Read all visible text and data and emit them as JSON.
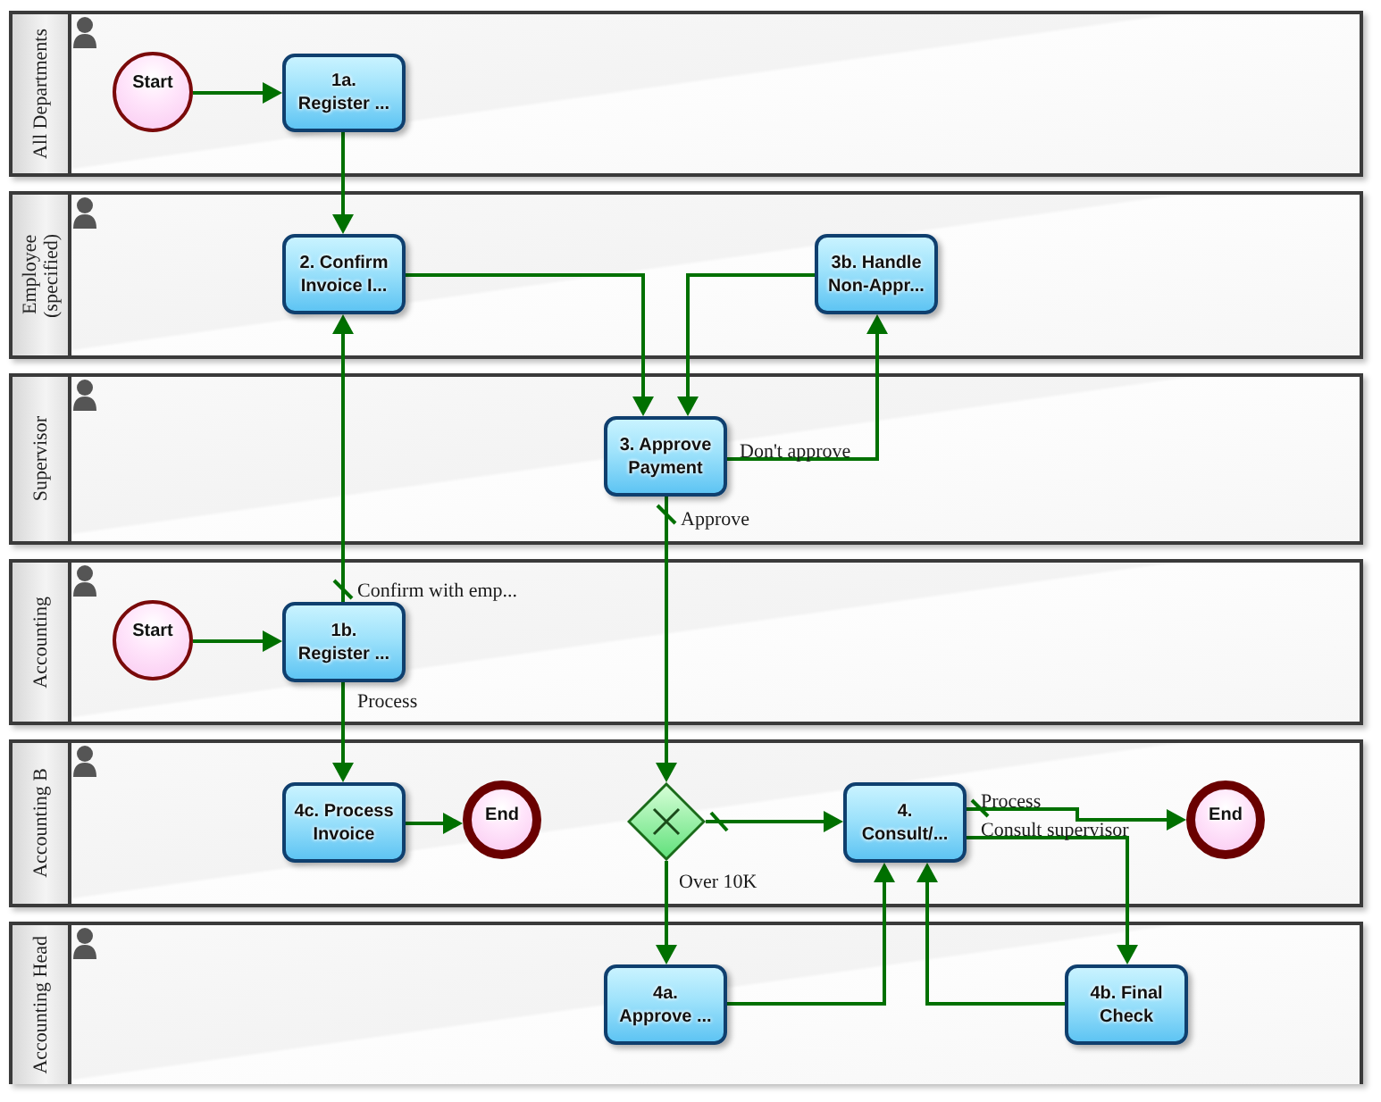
{
  "lanes": [
    {
      "label": "All Departments",
      "nodes": [
        {
          "kind": "start",
          "label": "Start"
        },
        {
          "kind": "task",
          "label": "1a.\nRegister ..."
        }
      ]
    },
    {
      "label": "Employee (specified)",
      "nodes": [
        {
          "kind": "task",
          "label": "2. Confirm\nInvoice I..."
        },
        {
          "kind": "task",
          "label": "3b. Handle\nNon-Appr..."
        }
      ]
    },
    {
      "label": "Supervisor",
      "nodes": [
        {
          "kind": "task",
          "label": "3. Approve\nPayment"
        }
      ]
    },
    {
      "label": "Accounting",
      "nodes": [
        {
          "kind": "start",
          "label": "Start"
        },
        {
          "kind": "task",
          "label": "1b.\nRegister ..."
        }
      ]
    },
    {
      "label": "Accounting B",
      "nodes": [
        {
          "kind": "task",
          "label": "4c. Process\nInvoice"
        },
        {
          "kind": "end",
          "label": "End"
        },
        {
          "kind": "gateway"
        },
        {
          "kind": "task",
          "label": "4.\nConsult/..."
        },
        {
          "kind": "end",
          "label": "End"
        }
      ]
    },
    {
      "label": "Accounting Head",
      "nodes": [
        {
          "kind": "task",
          "label": "4a.\nApprove ..."
        },
        {
          "kind": "task",
          "label": "4b. Final\nCheck"
        }
      ]
    }
  ],
  "connectors": [
    {
      "default": false
    },
    {
      "default": false
    },
    {
      "default": false
    },
    {
      "default": false
    },
    {
      "label": "Don't approve",
      "default": false
    },
    {
      "label": "Approve",
      "default": true
    },
    {
      "label": "Confirm with emp...",
      "default": true
    },
    {
      "default": false
    },
    {
      "label": "Process",
      "default": false
    },
    {
      "default": false
    },
    {
      "default": true
    },
    {
      "label": "Over 10K",
      "default": false
    },
    {
      "label": "Process",
      "default": true
    },
    {
      "label": "Consult supervisor",
      "default": false
    },
    {
      "default": false
    },
    {
      "default": false
    }
  ]
}
